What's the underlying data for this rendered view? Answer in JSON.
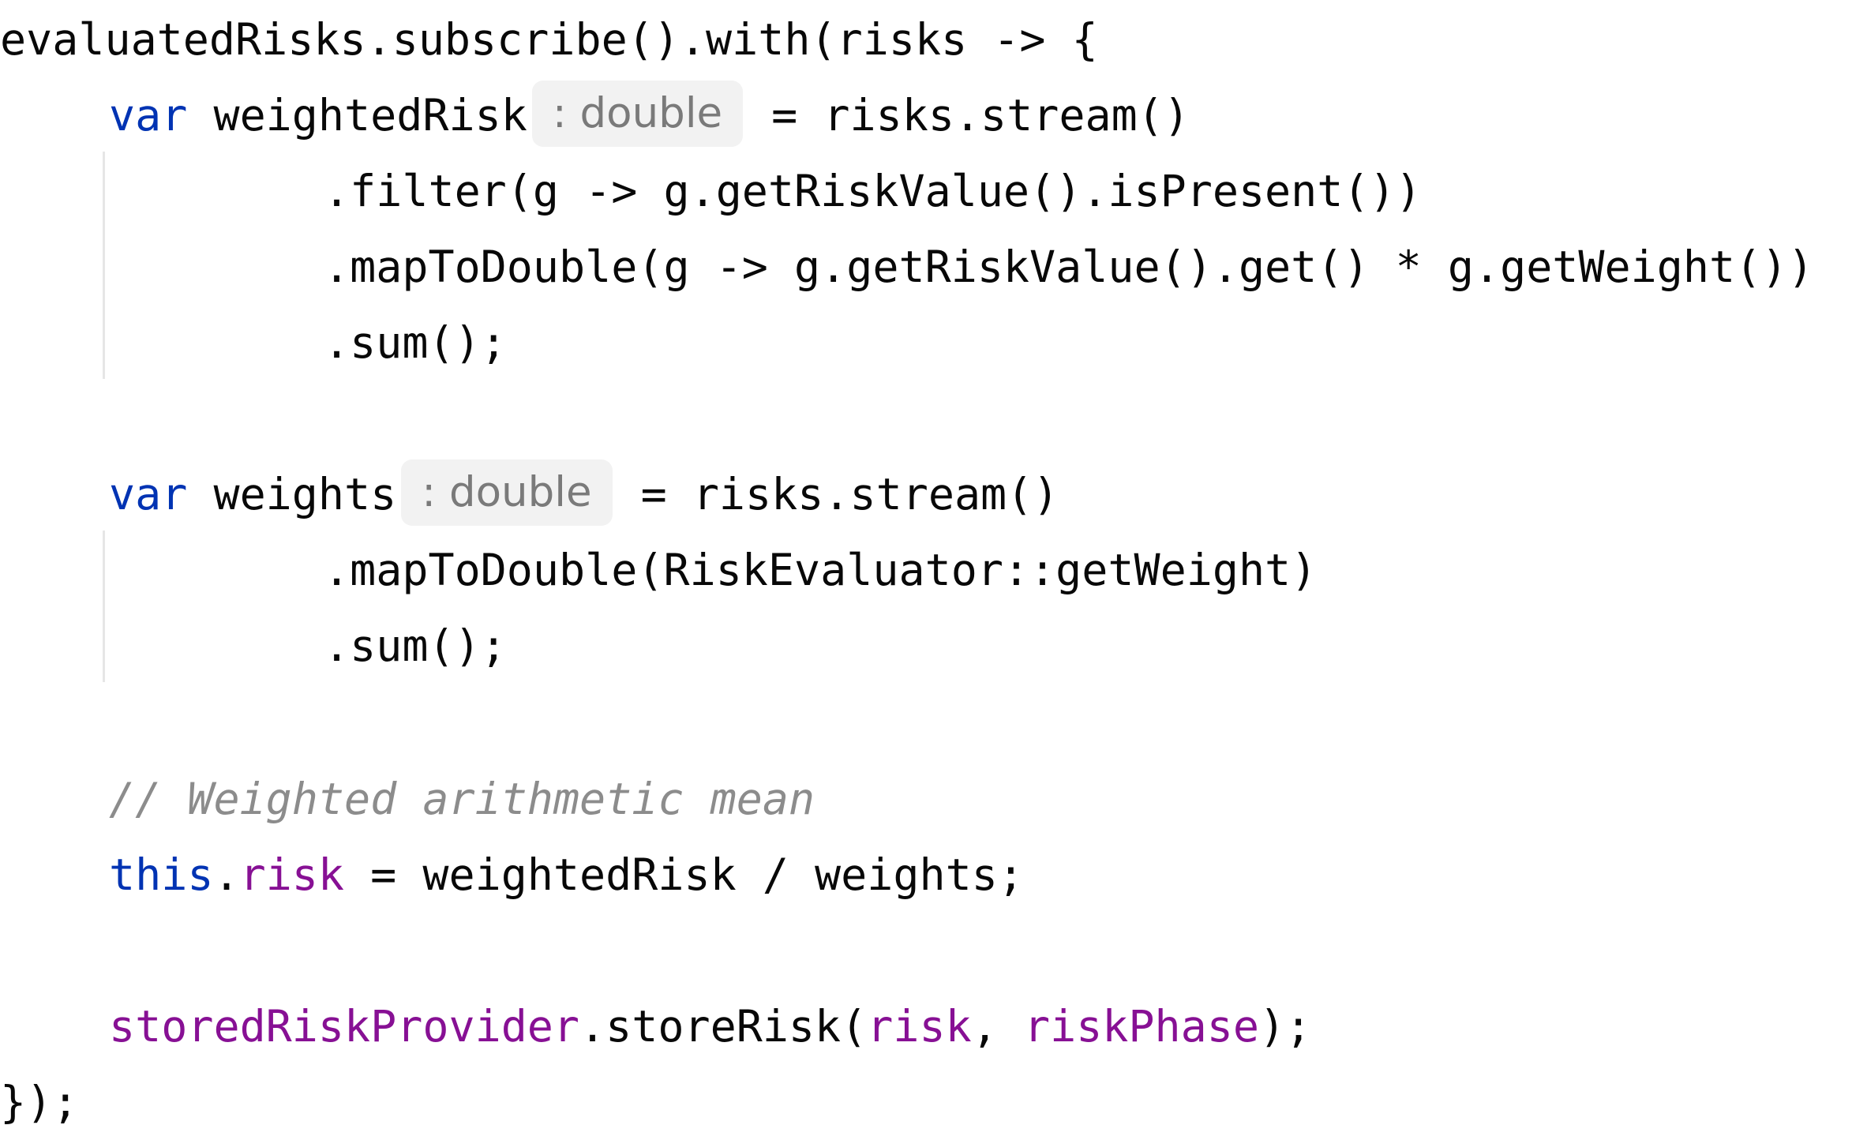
{
  "code": {
    "line1": {
      "receiver": "evaluatedRisks",
      "rest": ".subscribe().with(risks -> {"
    },
    "line2": {
      "keyword": "var",
      "name": " weightedRisk",
      "hint": ": double",
      "rest": "= risks.stream()"
    },
    "line3": {
      "text": ".filter(g -> g.getRiskValue().isPresent())"
    },
    "line4": {
      "text": ".mapToDouble(g -> g.getRiskValue().get() * g.getWeight())"
    },
    "line5": {
      "text": ".sum();"
    },
    "line6": {
      "keyword": "var",
      "name": " weights",
      "hint": ": double",
      "rest": "= risks.stream()"
    },
    "line7": {
      "text": ".mapToDouble(RiskEvaluator::getWeight)"
    },
    "line8": {
      "text": ".sum();"
    },
    "line9": {
      "comment": "// Weighted arithmetic mean"
    },
    "line10": {
      "keyword": "this",
      "dot": ".",
      "field": "risk",
      "rest": " = weightedRisk / weights;"
    },
    "line11": {
      "field": "storedRiskProvider",
      "method": ".storeRisk(",
      "arg1": "risk",
      "sep": ", ",
      "arg2": "riskPhase",
      "end": ");"
    },
    "line12": {
      "text": "});"
    }
  },
  "colors": {
    "keyword": "#0033b3",
    "field": "#871094",
    "comment": "#8c8c8c",
    "text": "#080808",
    "hint_background": "#f2f2f2",
    "hint_text": "#7a7a7a"
  }
}
